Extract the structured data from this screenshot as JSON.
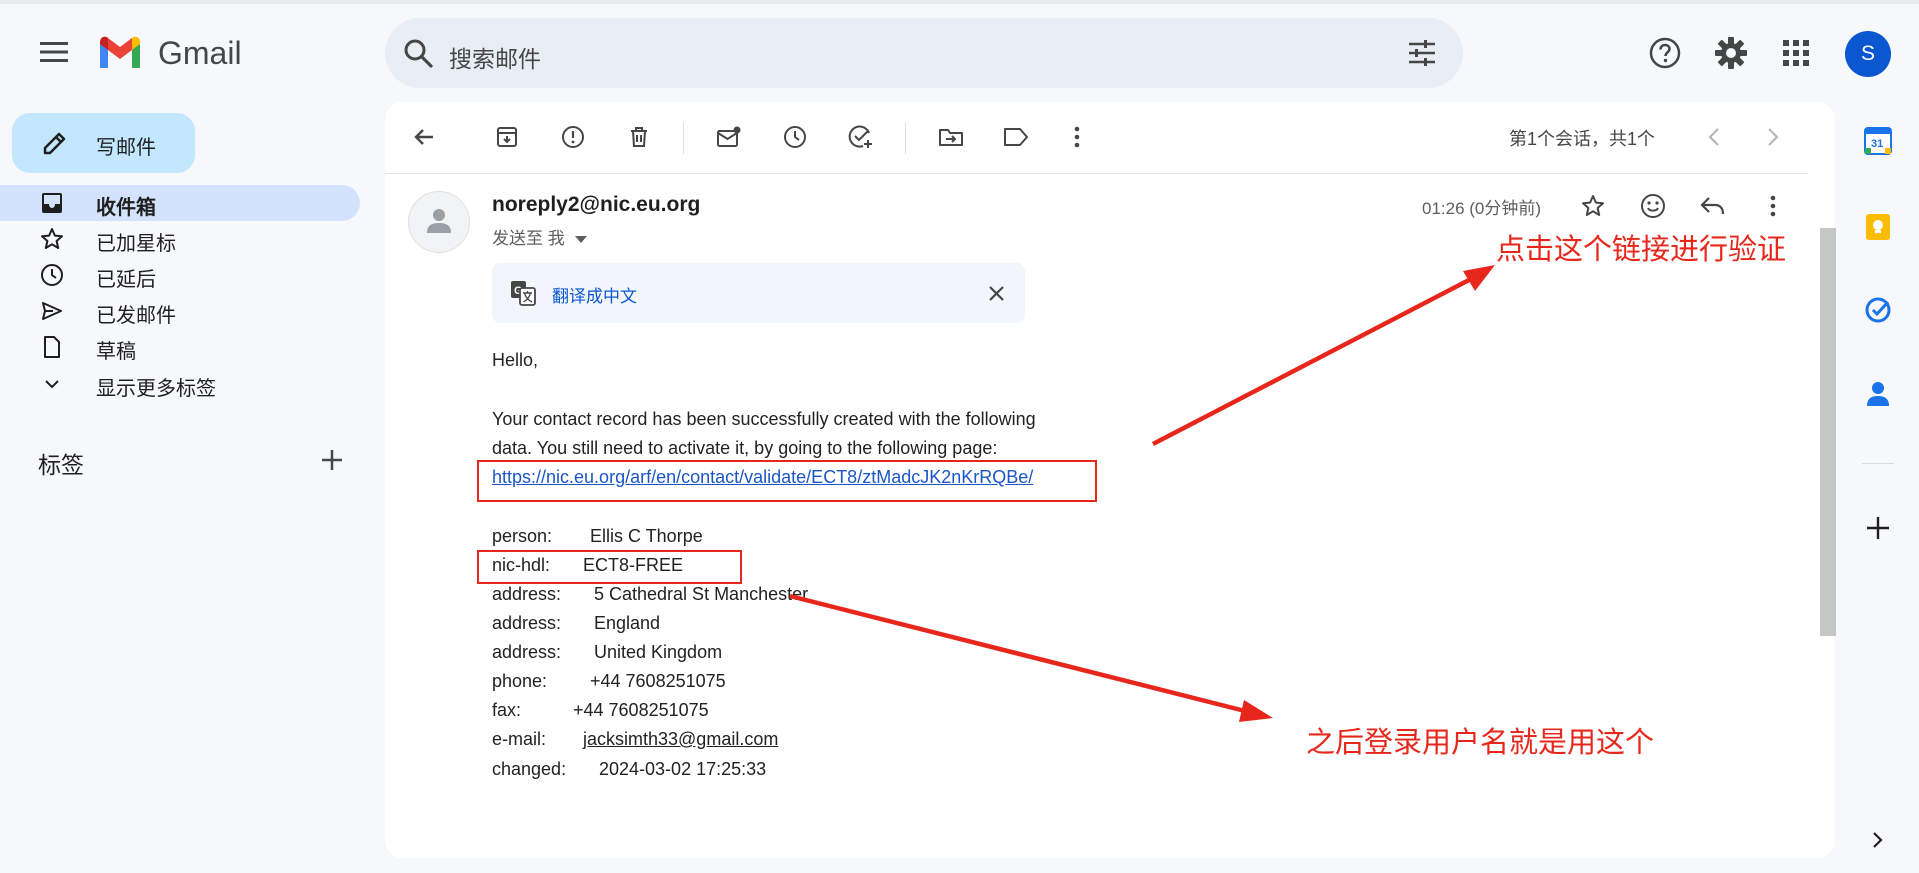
{
  "app": {
    "name": "Gmail"
  },
  "search": {
    "placeholder": "搜索邮件"
  },
  "account": {
    "avatar_letter": "S"
  },
  "compose": {
    "label": "写邮件"
  },
  "sidebar": {
    "items": [
      {
        "label": "收件箱",
        "icon": "inbox-icon",
        "active": true
      },
      {
        "label": "已加星标",
        "icon": "star-icon"
      },
      {
        "label": "已延后",
        "icon": "clock-icon"
      },
      {
        "label": "已发邮件",
        "icon": "send-icon"
      },
      {
        "label": "草稿",
        "icon": "draft-icon"
      },
      {
        "label": "显示更多标签",
        "icon": "chevron-down-icon"
      }
    ],
    "labels_heading": "标签"
  },
  "pager": {
    "text": "第1个会话，共1个"
  },
  "message": {
    "sender": "noreply2@nic.eu.org",
    "sent_to": "发送至 我",
    "time": "01:26 (0分钟前)",
    "translate_label": "翻译成中文",
    "greeting": "Hello,",
    "para_line1": "Your contact record has been successfully created with the following",
    "para_line2": "data. You still need to activate it, by going to the following page:",
    "validate_link": "https://nic.eu.org/arf/en/contact/validate/ECT8/ztMadcJK2nKrRQBe/",
    "fields": [
      {
        "key": "person:",
        "value": "Ellis C Thorpe"
      },
      {
        "key": "nic-hdl:",
        "value": "ECT8-FREE"
      },
      {
        "key": "address:",
        "value": "5 Cathedral St Manchester"
      },
      {
        "key": "address:",
        "value": "England"
      },
      {
        "key": "address:",
        "value": "United Kingdom"
      },
      {
        "key": "phone:",
        "value": "+44 7608251075"
      },
      {
        "key": "fax:",
        "value": "+44 7608251075"
      },
      {
        "key": "e-mail:",
        "value": "jacksimth33@gmail.com"
      },
      {
        "key": "changed:",
        "value": "2024-03-02 17:25:33"
      }
    ]
  },
  "annotations": {
    "click_link_note": "点击这个链接进行验证",
    "username_note": "之后登录用户名就是用这个",
    "color": "#e8271c"
  },
  "colors": {
    "background": "#f6f8fc",
    "compose_bg": "#c2e7ff",
    "active_nav": "#d3e3fd",
    "link": "#1a56c9",
    "avatar_bg": "#0b57d0"
  }
}
